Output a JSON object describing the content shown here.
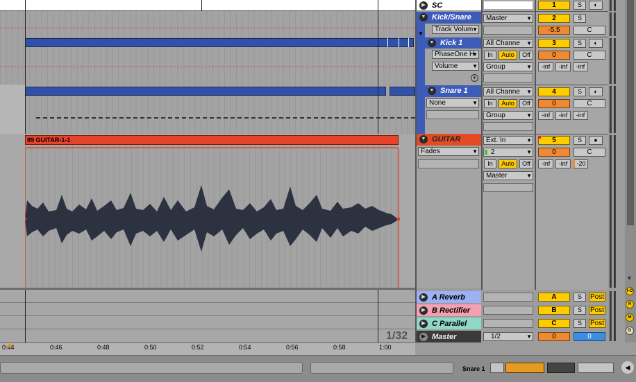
{
  "tracks": {
    "sc": {
      "name": "SC"
    },
    "kick_snare": {
      "name": "Kick/Snare",
      "input": "Master",
      "param": "Track Volum",
      "number": "2",
      "volume": "-5.5",
      "pan": "C"
    },
    "kick1": {
      "name": "Kick 1",
      "input": "All Channe",
      "device": "PhaseOne H",
      "param": "Volume",
      "output": "Group",
      "number": "3",
      "volume": "0",
      "pan": "C",
      "sends": [
        "-inf",
        "-inf",
        "-inf"
      ]
    },
    "snare1": {
      "name": "Snare 1",
      "input": "All Channe",
      "device": "None",
      "output": "Group",
      "number": "4",
      "volume": "0",
      "pan": "C",
      "sends": [
        "-inf",
        "-inf",
        "-inf"
      ]
    },
    "guitar": {
      "name": "GUITAR",
      "clip": "89 GUITAR-1-1",
      "param": "Fades",
      "input": "Ext. In",
      "channel": "2",
      "output": "Master",
      "number": "5",
      "volume": "0",
      "pan": "C",
      "sends": [
        "-inf",
        "-inf",
        "-20"
      ]
    }
  },
  "sc_number": "1",
  "monitor": {
    "in": "In",
    "auto": "Auto",
    "off": "Off"
  },
  "solo": "S",
  "returns": [
    {
      "name": "A Reverb",
      "letter": "A",
      "post": "Post",
      "color": "#9db0f5"
    },
    {
      "name": "B Rectifier",
      "letter": "B",
      "post": "Post",
      "color": "#f5a0b0"
    },
    {
      "name": "C Parallel",
      "letter": "C",
      "post": "Post",
      "color": "#8fd8c8"
    }
  ],
  "master": {
    "name": "Master",
    "cue": "1/2",
    "volume": "0",
    "pan": "0"
  },
  "timeline": {
    "ticks": [
      "0:44",
      "0:46",
      "0:48",
      "0:50",
      "0:52",
      "0:54",
      "0:56",
      "0:58",
      "1:00"
    ],
    "grid": "1/32"
  },
  "status": {
    "track": "Snare 1"
  },
  "io_labels": [
    "I-O",
    "R",
    "M",
    "D"
  ],
  "colors": {
    "blue_clip": "#3150a8",
    "guitar_clip": "#e6442a",
    "track_blue": "#3d5cb8",
    "guitar_header": "#e44b25"
  }
}
